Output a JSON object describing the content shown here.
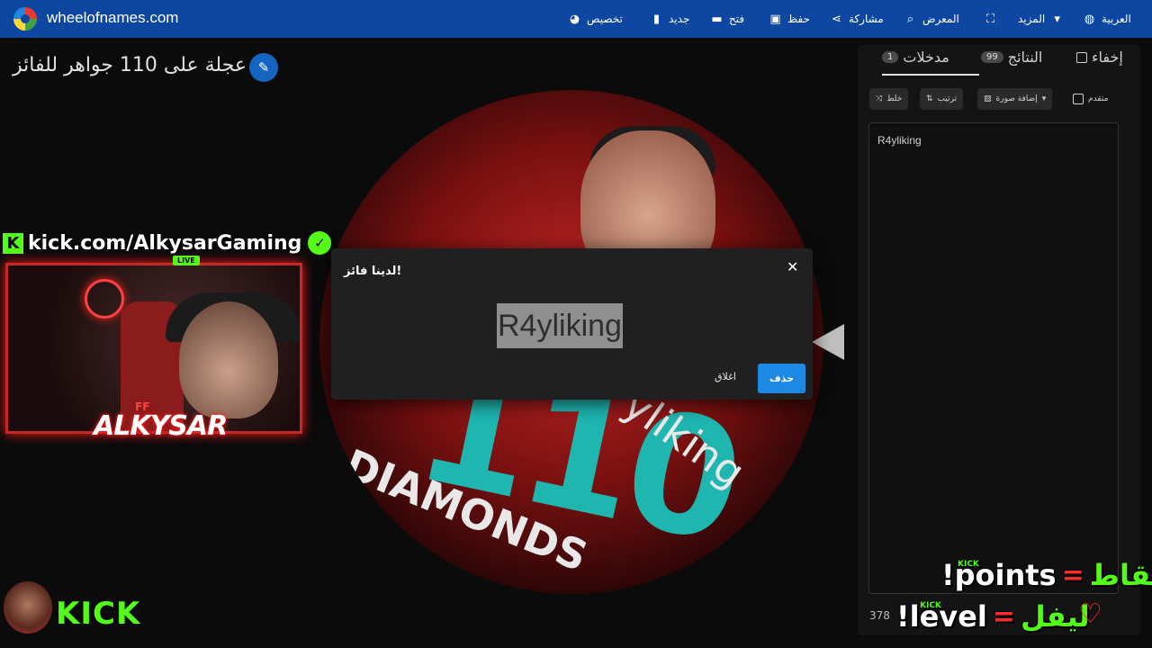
{
  "header": {
    "site_name": "wheelofnames.com",
    "menu": {
      "customize": "تخصيص",
      "new": "جديد",
      "open": "فتح",
      "save": "حفظ",
      "share": "مشاركة",
      "gallery": "المعرض",
      "more": "المزيد",
      "language": "العربية"
    },
    "icons": {
      "customize": "palette-icon",
      "new": "file-icon",
      "open": "folder-icon",
      "save": "save-icon",
      "share": "share-icon",
      "gallery": "search-icon",
      "fullscreen": "fullscreen-icon",
      "more": "chevron-down-icon",
      "language": "globe-icon"
    }
  },
  "wheel": {
    "title": "عجلة على 110 جواهر للفائز",
    "slice_texts": {
      "number": "110",
      "word": "DIAMONDS",
      "name_fragment": "yliking"
    }
  },
  "panel": {
    "tabs": {
      "entries": {
        "label": "مدخلات",
        "count": "1"
      },
      "results": {
        "label": "النتائج",
        "count": "99"
      },
      "hide": "إخفاء"
    },
    "toolbar": {
      "shuffle": "خلط",
      "sort": "ترتيب",
      "add_image": "إضافة صورة",
      "advanced": "متقدم"
    },
    "entries": [
      "R4yliking"
    ],
    "footer_count": "378"
  },
  "dialog": {
    "title": "لدينا فائز!",
    "winner": "R4yliking",
    "close_label": "اغلاق",
    "remove_label": "حذف"
  },
  "overlay": {
    "kick_url": "kick.com/AlkysarGaming",
    "live_badge": "LIVE",
    "streamer_name": "ALKYSAR",
    "ff_tag": "FF",
    "kick_brand": "KICK",
    "points_ar": "نقاط",
    "points_en": "!points",
    "level_ar": "ليفل",
    "level_en": "!level",
    "equals": "=",
    "kick_small": "KICK"
  },
  "colors": {
    "header_blue": "#0d47a1",
    "kick_green": "#53fc18",
    "accent_red": "#ff2a2a",
    "dialog_button": "#1e88e5"
  }
}
